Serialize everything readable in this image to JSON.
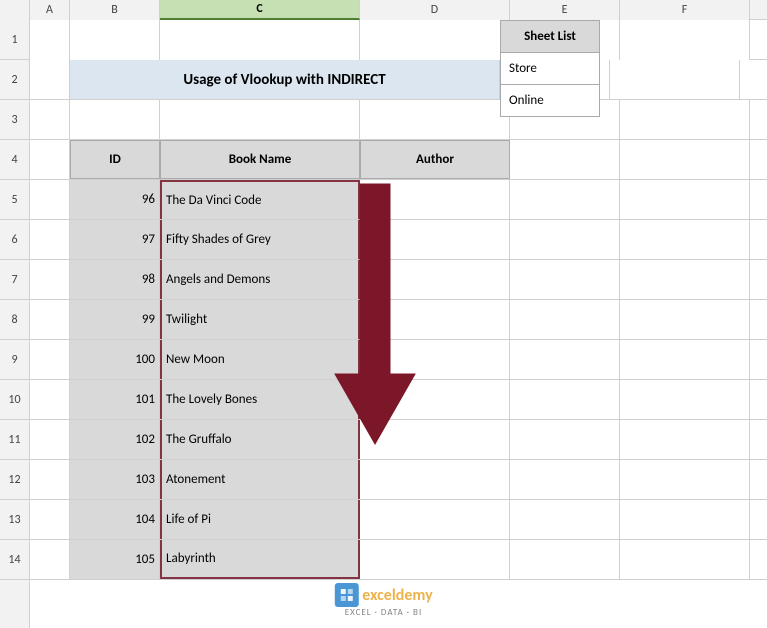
{
  "title": "Usage of Vlookup with INDIRECT",
  "columns": {
    "A": "A",
    "B": "B",
    "C": "C",
    "D": "D",
    "E": "E",
    "F": "F"
  },
  "headers": {
    "id": "ID",
    "bookName": "Book Name",
    "author": "Author"
  },
  "rows": [
    {
      "id": "96",
      "book": "The Da Vinci Code"
    },
    {
      "id": "97",
      "book": "Fifty Shades of Grey"
    },
    {
      "id": "98",
      "book": "Angels and Demons"
    },
    {
      "id": "99",
      "book": "Twilight"
    },
    {
      "id": "100",
      "book": "New Moon"
    },
    {
      "id": "101",
      "book": "The Lovely Bones"
    },
    {
      "id": "102",
      "book": "The Gruffalo"
    },
    {
      "id": "103",
      "book": "Atonement"
    },
    {
      "id": "104",
      "book": "Life of Pi"
    },
    {
      "id": "105",
      "book": "Labyrinth"
    }
  ],
  "sheetList": {
    "header": "Sheet List",
    "items": [
      "Store",
      "Online"
    ]
  },
  "rowNumbers": [
    "1",
    "2",
    "3",
    "4",
    "5",
    "6",
    "7",
    "8",
    "9",
    "10",
    "11",
    "12",
    "13",
    "14"
  ],
  "watermark": {
    "brand": "exceldemy",
    "tagline": "EXCEL · DATA · BI"
  }
}
